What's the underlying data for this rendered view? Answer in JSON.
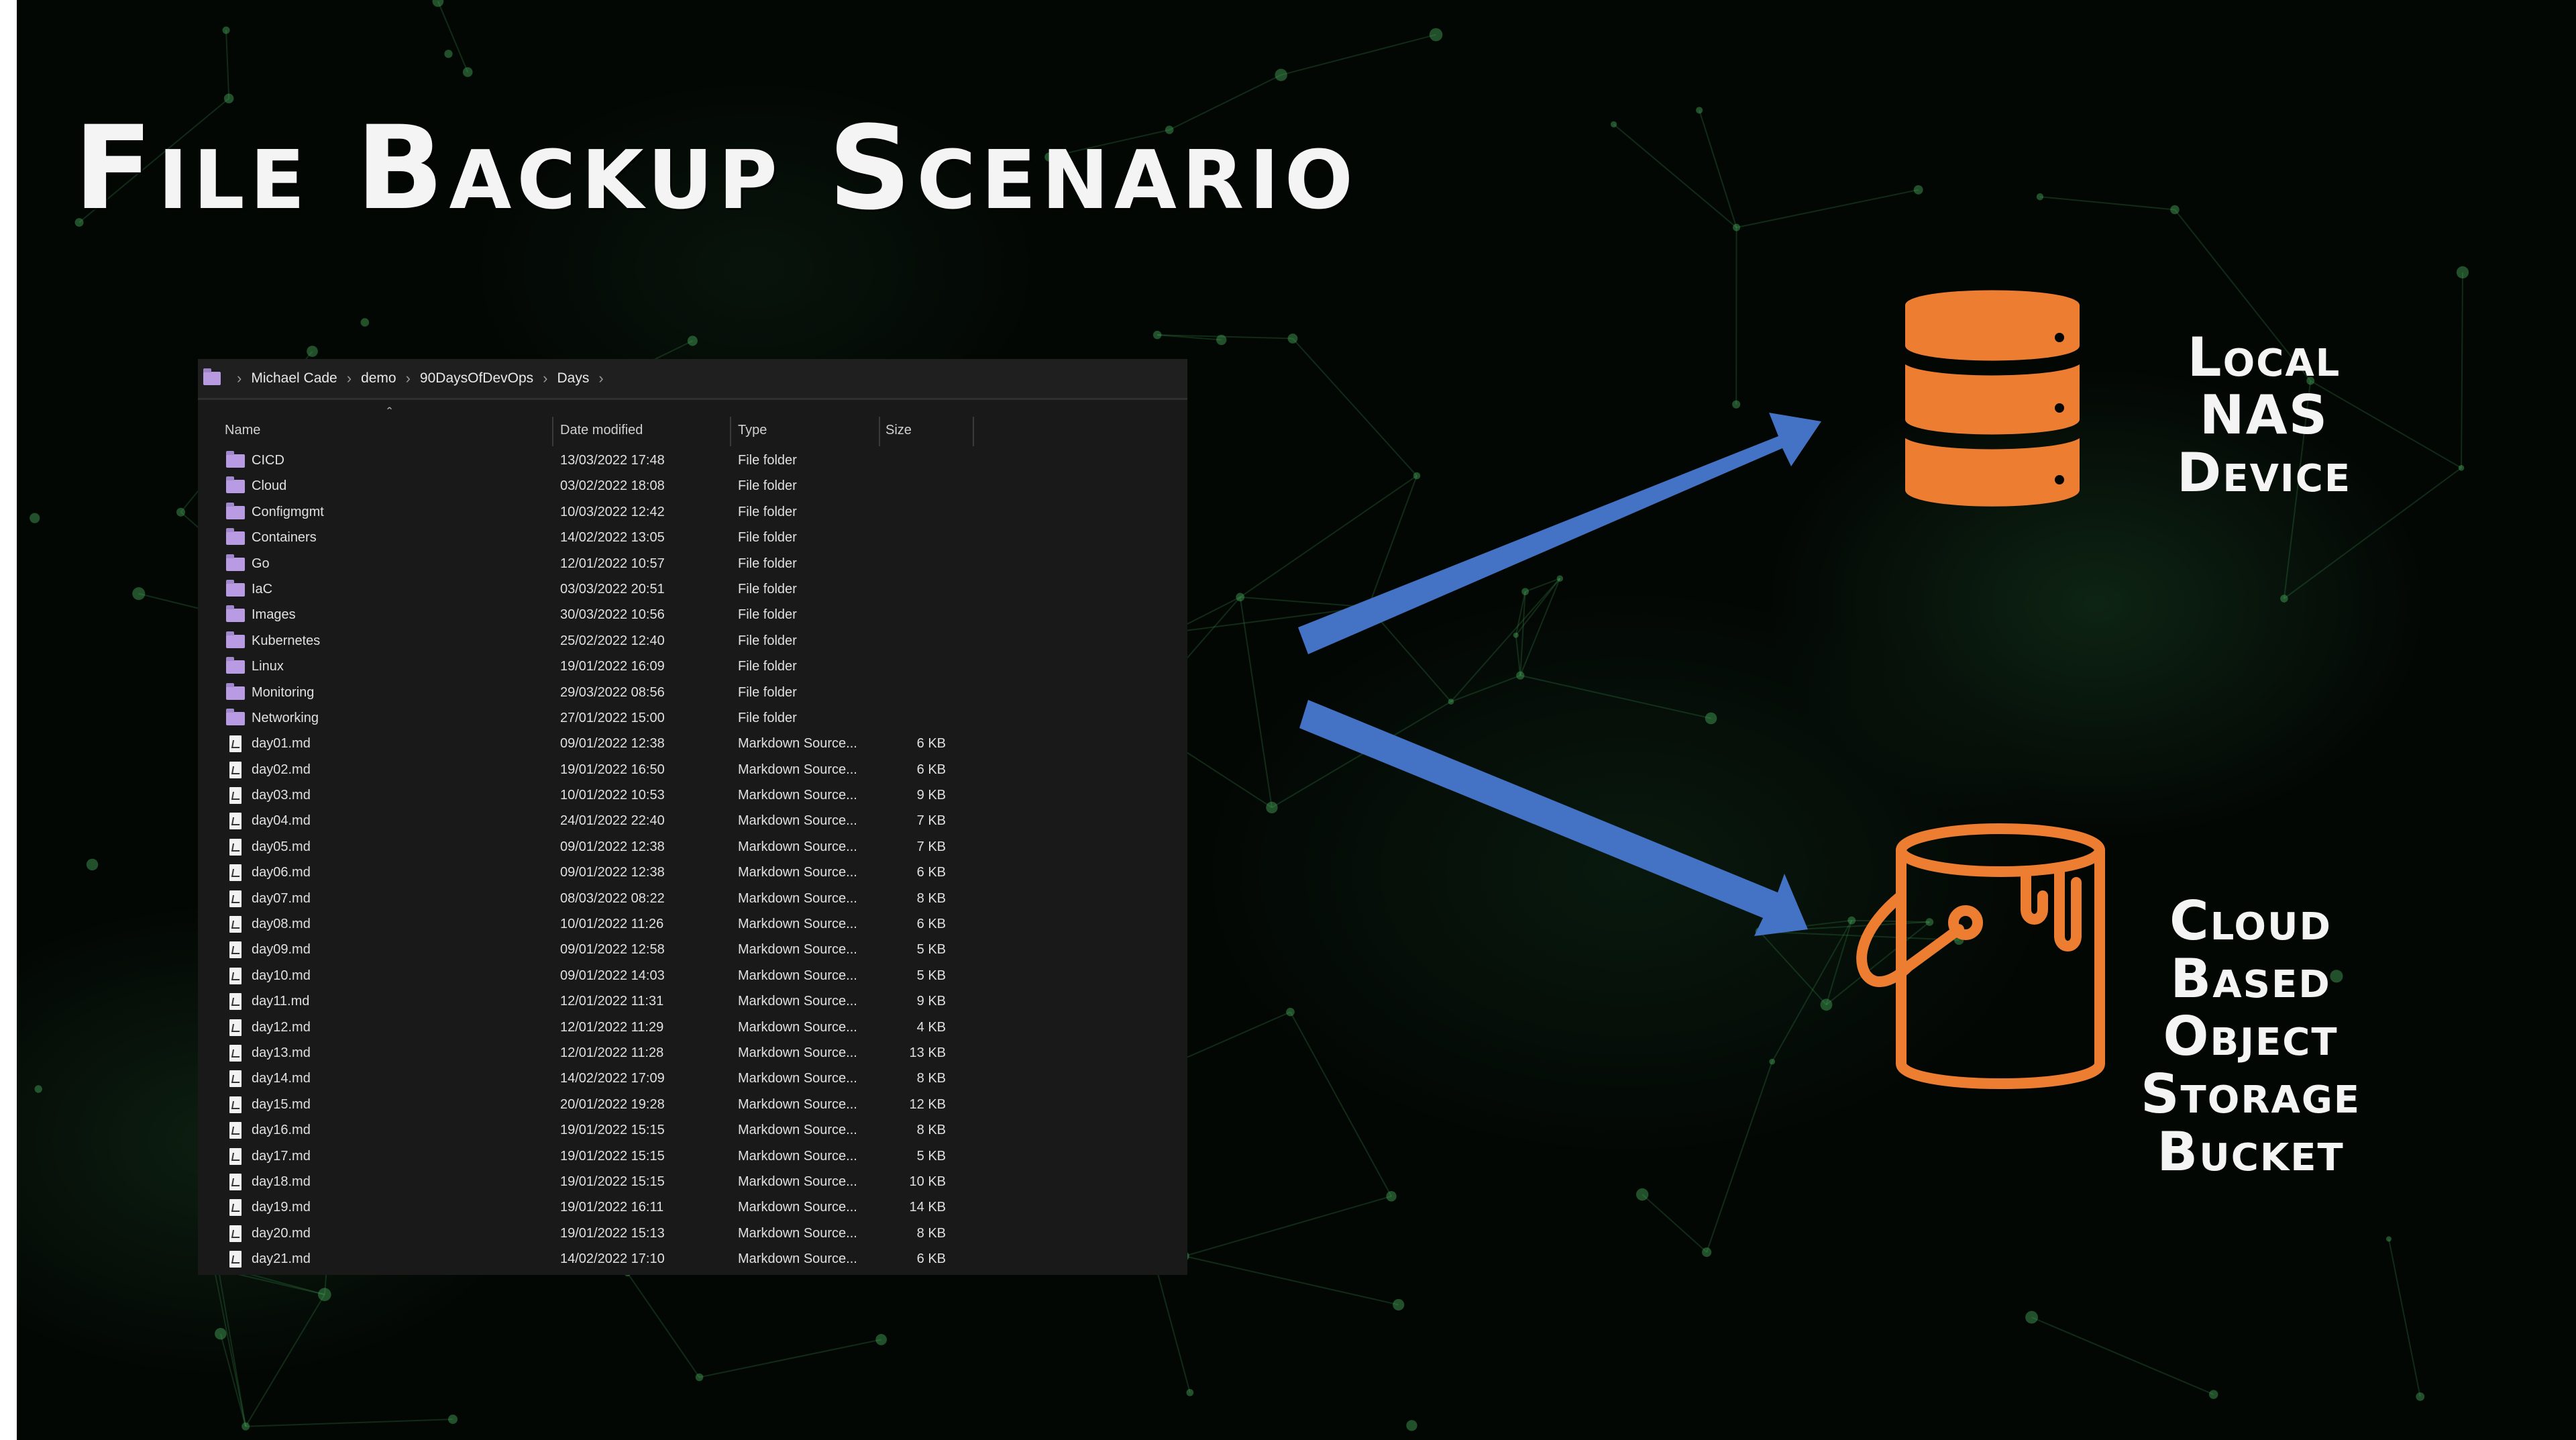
{
  "slide": {
    "title": "File Backup Scenario",
    "nas_label_line1": "Local NAS",
    "nas_label_line2": "Device",
    "cloud_label_lines": [
      "Cloud",
      "Based",
      "Object",
      "Storage",
      "Bucket"
    ]
  },
  "explorer": {
    "breadcrumb": [
      "Michael Cade",
      "demo",
      "90DaysOfDevOps",
      "Days"
    ],
    "columns": {
      "name": "Name",
      "date": "Date modified",
      "type": "Type",
      "size": "Size"
    },
    "rows": [
      {
        "kind": "folder",
        "name": "CICD",
        "date": "13/03/2022 17:48",
        "type": "File folder",
        "size": ""
      },
      {
        "kind": "folder",
        "name": "Cloud",
        "date": "03/02/2022 18:08",
        "type": "File folder",
        "size": ""
      },
      {
        "kind": "folder",
        "name": "Configmgmt",
        "date": "10/03/2022 12:42",
        "type": "File folder",
        "size": ""
      },
      {
        "kind": "folder",
        "name": "Containers",
        "date": "14/02/2022 13:05",
        "type": "File folder",
        "size": ""
      },
      {
        "kind": "folder",
        "name": "Go",
        "date": "12/01/2022 10:57",
        "type": "File folder",
        "size": ""
      },
      {
        "kind": "folder",
        "name": "IaC",
        "date": "03/03/2022 20:51",
        "type": "File folder",
        "size": ""
      },
      {
        "kind": "folder",
        "name": "Images",
        "date": "30/03/2022 10:56",
        "type": "File folder",
        "size": ""
      },
      {
        "kind": "folder",
        "name": "Kubernetes",
        "date": "25/02/2022 12:40",
        "type": "File folder",
        "size": ""
      },
      {
        "kind": "folder",
        "name": "Linux",
        "date": "19/01/2022 16:09",
        "type": "File folder",
        "size": ""
      },
      {
        "kind": "folder",
        "name": "Monitoring",
        "date": "29/03/2022 08:56",
        "type": "File folder",
        "size": ""
      },
      {
        "kind": "folder",
        "name": "Networking",
        "date": "27/01/2022 15:00",
        "type": "File folder",
        "size": ""
      },
      {
        "kind": "file",
        "name": "day01.md",
        "date": "09/01/2022 12:38",
        "type": "Markdown Source...",
        "size": "6 KB"
      },
      {
        "kind": "file",
        "name": "day02.md",
        "date": "19/01/2022 16:50",
        "type": "Markdown Source...",
        "size": "6 KB"
      },
      {
        "kind": "file",
        "name": "day03.md",
        "date": "10/01/2022 10:53",
        "type": "Markdown Source...",
        "size": "9 KB"
      },
      {
        "kind": "file",
        "name": "day04.md",
        "date": "24/01/2022 22:40",
        "type": "Markdown Source...",
        "size": "7 KB"
      },
      {
        "kind": "file",
        "name": "day05.md",
        "date": "09/01/2022 12:38",
        "type": "Markdown Source...",
        "size": "7 KB"
      },
      {
        "kind": "file",
        "name": "day06.md",
        "date": "09/01/2022 12:38",
        "type": "Markdown Source...",
        "size": "6 KB"
      },
      {
        "kind": "file",
        "name": "day07.md",
        "date": "08/03/2022 08:22",
        "type": "Markdown Source...",
        "size": "8 KB"
      },
      {
        "kind": "file",
        "name": "day08.md",
        "date": "10/01/2022 11:26",
        "type": "Markdown Source...",
        "size": "6 KB"
      },
      {
        "kind": "file",
        "name": "day09.md",
        "date": "09/01/2022 12:58",
        "type": "Markdown Source...",
        "size": "5 KB"
      },
      {
        "kind": "file",
        "name": "day10.md",
        "date": "09/01/2022 14:03",
        "type": "Markdown Source...",
        "size": "5 KB"
      },
      {
        "kind": "file",
        "name": "day11.md",
        "date": "12/01/2022 11:31",
        "type": "Markdown Source...",
        "size": "9 KB"
      },
      {
        "kind": "file",
        "name": "day12.md",
        "date": "12/01/2022 11:29",
        "type": "Markdown Source...",
        "size": "4 KB"
      },
      {
        "kind": "file",
        "name": "day13.md",
        "date": "12/01/2022 11:28",
        "type": "Markdown Source...",
        "size": "13 KB"
      },
      {
        "kind": "file",
        "name": "day14.md",
        "date": "14/02/2022 17:09",
        "type": "Markdown Source...",
        "size": "8 KB"
      },
      {
        "kind": "file",
        "name": "day15.md",
        "date": "20/01/2022 19:28",
        "type": "Markdown Source...",
        "size": "12 KB"
      },
      {
        "kind": "file",
        "name": "day16.md",
        "date": "19/01/2022 15:15",
        "type": "Markdown Source...",
        "size": "8 KB"
      },
      {
        "kind": "file",
        "name": "day17.md",
        "date": "19/01/2022 15:15",
        "type": "Markdown Source...",
        "size": "5 KB"
      },
      {
        "kind": "file",
        "name": "day18.md",
        "date": "19/01/2022 15:15",
        "type": "Markdown Source...",
        "size": "10 KB"
      },
      {
        "kind": "file",
        "name": "day19.md",
        "date": "19/01/2022 16:11",
        "type": "Markdown Source...",
        "size": "14 KB"
      },
      {
        "kind": "file",
        "name": "day20.md",
        "date": "19/01/2022 15:13",
        "type": "Markdown Source...",
        "size": "8 KB"
      },
      {
        "kind": "file",
        "name": "day21.md",
        "date": "14/02/2022 17:10",
        "type": "Markdown Source...",
        "size": "6 KB"
      }
    ]
  },
  "colors": {
    "arrow": "#4472c4",
    "icon_orange": "#ed7d31",
    "folder_purple": "#b89be3"
  },
  "icons": {
    "nas": "database-icon",
    "bucket": "bucket-icon",
    "folder": "folder-icon",
    "file": "markdown-file-icon"
  }
}
